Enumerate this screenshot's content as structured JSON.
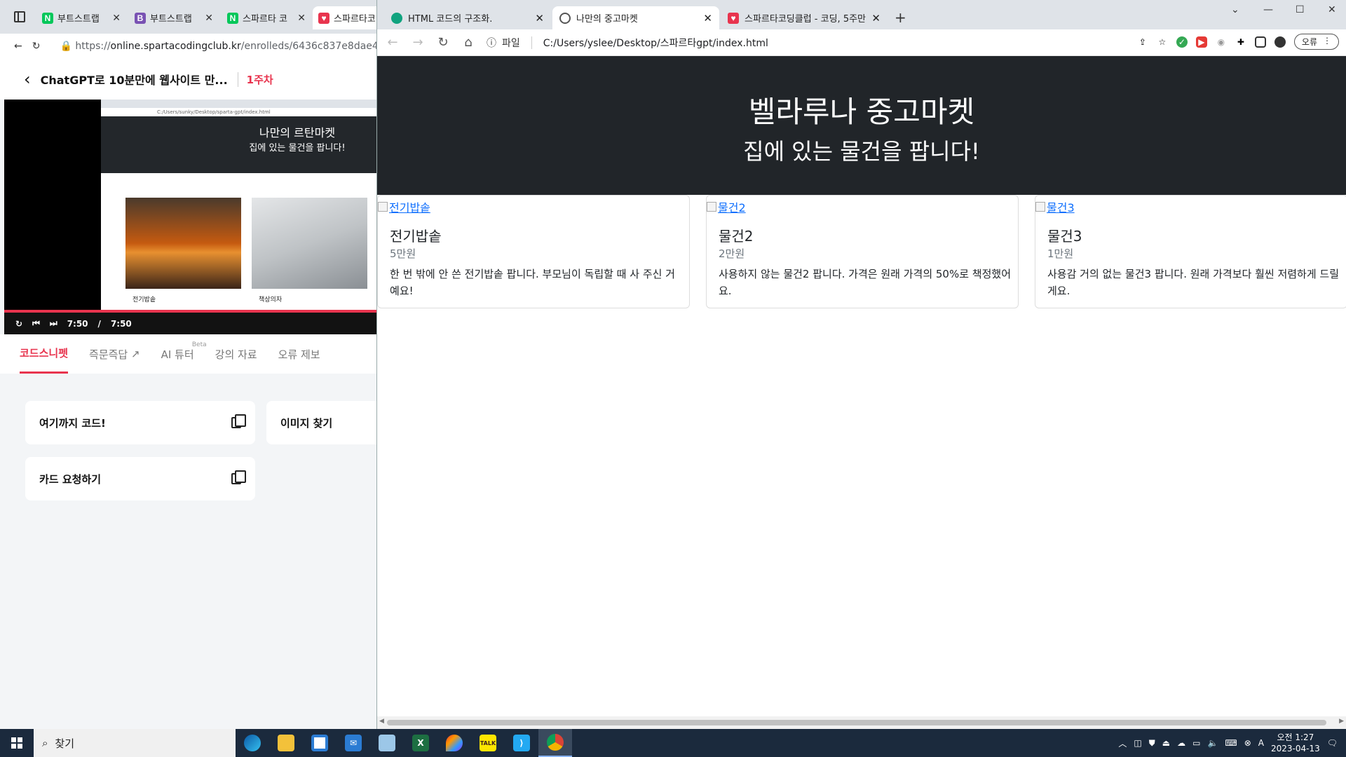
{
  "left_window": {
    "tabs": [
      {
        "label": "부트스트랩",
        "favicon": "N",
        "favicon_color": "#03c75a"
      },
      {
        "label": "부트스트랩",
        "favicon": "B",
        "favicon_color": "#7952b3"
      },
      {
        "label": "스파르타 코",
        "favicon": "N",
        "favicon_color": "#03c75a"
      },
      {
        "label": "스파르타코",
        "favicon": "♥",
        "favicon_color": "#e8344e"
      }
    ],
    "url_prefix": "https://",
    "url_host": "online.spartacodingclub.kr",
    "url_path": "/enrolleds/6436c837e8dae4",
    "course_title": "ChatGPT로 10분만에 웹사이트 만...",
    "week": "1주차",
    "video": {
      "inner_title": "나만의 르탄마켓",
      "inner_sub": "집에 있는 물건을 팝니다!",
      "inner_url": "C:/Users/sunky/Desktop/sparta-gpt/index.html",
      "caption1": "전기밥솥",
      "caption2": "책상의자",
      "time_current": "7:50",
      "time_sep": "/",
      "time_total": "7:50",
      "progress": 1.0
    },
    "content_tabs": [
      {
        "label": "코드스니펫",
        "active": true
      },
      {
        "label": "즉문즉답",
        "external": true
      },
      {
        "label": "AI 튜터",
        "badge": "Beta"
      },
      {
        "label": "강의 자료"
      },
      {
        "label": "오류 제보"
      }
    ],
    "snippets": [
      {
        "label": "여기까지 코드!"
      },
      {
        "label": "이미지 찾기"
      },
      {
        "label": "카드 요청하기"
      }
    ]
  },
  "right_window": {
    "tabs": [
      {
        "label": "HTML 코드의 구조화.",
        "favicon": "gpt-icon",
        "active": false
      },
      {
        "label": "나만의 중고마켓",
        "favicon": "globe-icon",
        "active": true
      },
      {
        "label": "스파르타코딩클럽 - 코딩, 5주만",
        "favicon": "heart-icon",
        "active": false
      }
    ],
    "address_scheme": "파일",
    "address_path": "C:/Users/yslee/Desktop/스파르타gpt/index.html",
    "error_button": "오류",
    "page": {
      "title": "벨라루나 중고마켓",
      "subtitle": "집에 있는 물건을 팝니다!",
      "cards": [
        {
          "img_alt": "전기밥솥",
          "title": "전기밥솥",
          "price": "5만원",
          "desc": "한 번 밖에 안 쓴 전기밥솥 팝니다. 부모님이 독립할 때 사 주신 거예요!"
        },
        {
          "img_alt": "물건2",
          "title": "물건2",
          "price": "2만원",
          "desc": "사용하지 않는 물건2 팝니다. 가격은 원래 가격의 50%로 책정했어요."
        },
        {
          "img_alt": "물건3",
          "title": "물건3",
          "price": "1만원",
          "desc": "사용감 거의 없는 물건3 팝니다. 원래 가격보다 훨씬 저렴하게 드릴게요."
        }
      ]
    }
  },
  "taskbar": {
    "search_label": "찾기",
    "apps": [
      "edge-icon",
      "file-explorer-icon",
      "store-icon",
      "mail-icon",
      "notepad-icon",
      "excel-icon",
      "color-picker-icon",
      "kakaotalk-icon",
      "vscode-icon",
      "chrome-icon"
    ],
    "kakao_label": "TALK",
    "ime": "A",
    "time_period": "오전 1:27",
    "date": "2023-04-13"
  }
}
